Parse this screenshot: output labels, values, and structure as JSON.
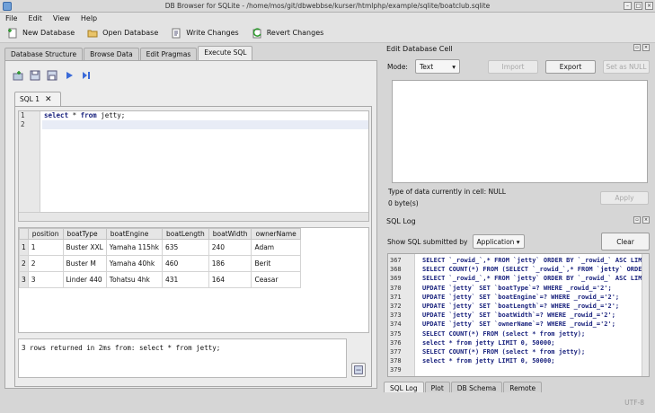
{
  "window": {
    "title": "DB Browser for SQLite - /home/mos/git/dbwebbse/kurser/htmlphp/example/sqlite/boatclub.sqlite"
  },
  "menu": [
    "File",
    "Edit",
    "View",
    "Help"
  ],
  "toolbar": {
    "new_database": "New Database",
    "open_database": "Open Database",
    "write_changes": "Write Changes",
    "revert_changes": "Revert Changes"
  },
  "main_tabs": [
    "Database Structure",
    "Browse Data",
    "Edit Pragmas",
    "Execute SQL"
  ],
  "sql_tab": {
    "label": "SQL 1"
  },
  "editor": {
    "line_numbers": [
      "1",
      "2"
    ],
    "lines": [
      [
        {
          "t": "select",
          "kw": true
        },
        {
          "t": " * ",
          "kw": false
        },
        {
          "t": "from",
          "kw": true
        },
        {
          "t": " jetty;",
          "kw": false
        }
      ],
      []
    ]
  },
  "results": {
    "columns": [
      "position",
      "boatType",
      "boatEngine",
      "boatLength",
      "boatWidth",
      "ownerName"
    ],
    "rows": [
      [
        "1",
        "1",
        "Buster XXL",
        "Yamaha 115hk",
        "635",
        "240",
        "Adam"
      ],
      [
        "2",
        "2",
        "Buster M",
        "Yamaha 40hk",
        "460",
        "186",
        "Berit"
      ],
      [
        "3",
        "3",
        "Linder 440",
        "Tohatsu 4hk",
        "431",
        "164",
        "Ceasar"
      ]
    ]
  },
  "message": "3 rows returned in 2ms from: select * from jetty;",
  "edit_cell": {
    "title": "Edit Database Cell",
    "mode_label": "Mode:",
    "mode_value": "Text",
    "import": "Import",
    "export": "Export",
    "set_null": "Set as NULL",
    "type_text": "Type of data currently in cell: NULL",
    "size_text": "0 byte(s)",
    "apply": "Apply"
  },
  "sql_log": {
    "title": "SQL Log",
    "show_label": "Show SQL submitted by",
    "source": "Application",
    "clear": "Clear",
    "entries": [
      {
        "n": "367",
        "t": "SELECT `_rowid_`,* FROM `jetty` ORDER BY `_rowid_` ASC LIMIT 0, 4"
      },
      {
        "n": "368",
        "t": "SELECT COUNT(*) FROM (SELECT `_rowid_`,* FROM `jetty` ORDER BY `_r"
      },
      {
        "n": "369",
        "t": "SELECT `_rowid_`,* FROM `jetty` ORDER BY `_rowid_` ASC LIMIT 0, 4"
      },
      {
        "n": "370",
        "t": "UPDATE `jetty` SET `boatType`=? WHERE _rowid_='2';"
      },
      {
        "n": "371",
        "t": "UPDATE `jetty` SET `boatEngine`=? WHERE _rowid_='2';"
      },
      {
        "n": "372",
        "t": "UPDATE `jetty` SET `boatLength`=? WHERE _rowid_='2';"
      },
      {
        "n": "373",
        "t": "UPDATE `jetty` SET `boatWidth`=? WHERE _rowid_='2';"
      },
      {
        "n": "374",
        "t": "UPDATE `jetty` SET `ownerName`=? WHERE _rowid_='2';"
      },
      {
        "n": "375",
        "t": "SELECT COUNT(*) FROM (select * from jetty);"
      },
      {
        "n": "376",
        "t": "select * from jetty LIMIT 0, 50000;"
      },
      {
        "n": "377",
        "t": "SELECT COUNT(*) FROM (select * from jetty);"
      },
      {
        "n": "378",
        "t": "select * from jetty LIMIT 0, 50000;"
      },
      {
        "n": "379",
        "t": ""
      }
    ]
  },
  "right_tabs": [
    "SQL Log",
    "Plot",
    "DB Schema",
    "Remote"
  ],
  "status": {
    "encoding": "UTF-8"
  }
}
